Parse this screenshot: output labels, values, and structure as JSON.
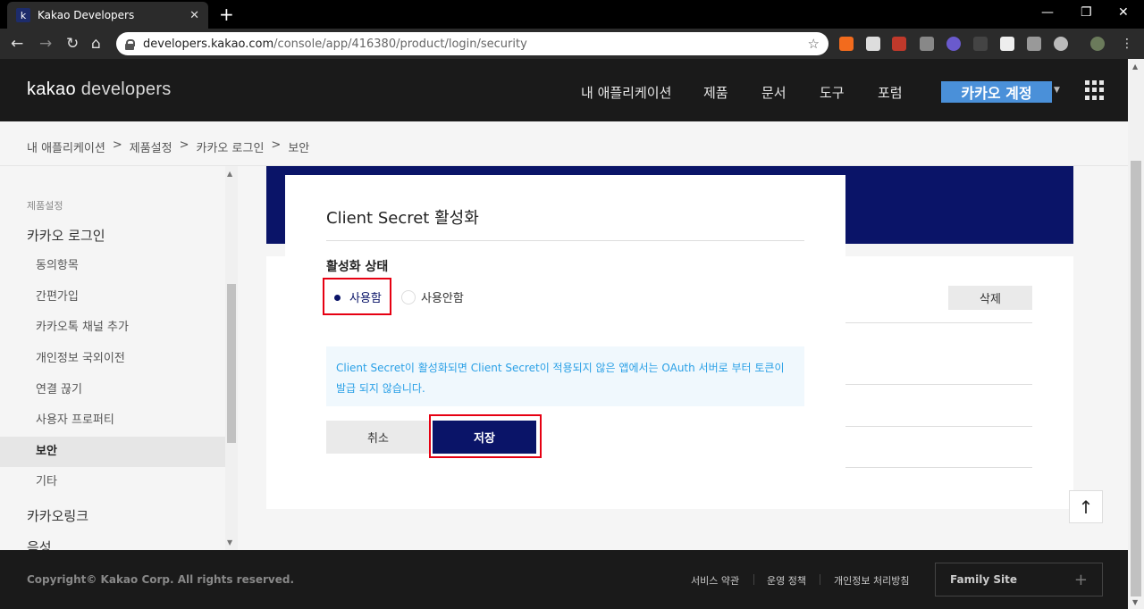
{
  "browser": {
    "tab_title": "Kakao Developers",
    "favicon_letter": "k",
    "tab_close": "✕",
    "new_tab": "+",
    "url_host": "developers.kakao.com",
    "url_path": "/console/app/416380/product/login/security",
    "controls": {
      "minimize": "—",
      "maximize": "❐",
      "close": "✕"
    }
  },
  "header": {
    "logo_a": "kakao",
    "logo_b": " developers",
    "nav": [
      "내 애플리케이션",
      "제품",
      "문서",
      "도구",
      "포럼"
    ],
    "account_label": "카카오 계정"
  },
  "breadcrumb": [
    "내 애플리케이션",
    ">",
    "제품설정",
    ">",
    "카카오 로그인",
    ">",
    "보안"
  ],
  "sidebar": {
    "section_label": "제품설정",
    "group_login": "카카오 로그인",
    "items": [
      "동의항목",
      "간편가입",
      "카카오톡 채널 추가",
      "개인정보 국외이전",
      "연결 끊기",
      "사용자 프로퍼티",
      "보안",
      "기타"
    ],
    "active_item": "보안",
    "group_kakaolink": "카카오링크",
    "group_voice": "음성"
  },
  "main": {
    "delete_label": "삭제",
    "scroll_top": "↑"
  },
  "modal": {
    "title": "Client Secret 활성화",
    "field_label": "활성화 상태",
    "options": [
      "사용함",
      "사용안함"
    ],
    "selected_option": "사용함",
    "info_line1": "Client Secret이 활성화되면 Client Secret이 적용되지 않은 앱에서는 OAuth 서버로 부터 토큰이",
    "info_line2": "발급 되지 않습니다.",
    "cancel_label": "취소",
    "save_label": "저장"
  },
  "footer": {
    "copyright": "Copyright© Kakao Corp. All rights reserved.",
    "links": [
      "서비스 약관",
      "운영 정책",
      "개인정보 처리방침"
    ],
    "family_site": "Family Site",
    "family_plus": "+"
  },
  "colors": {
    "brand_navy": "#0a1468",
    "account_blue": "#4a90d9",
    "info_text": "#2aa0e6",
    "highlight_red": "#e60012"
  }
}
